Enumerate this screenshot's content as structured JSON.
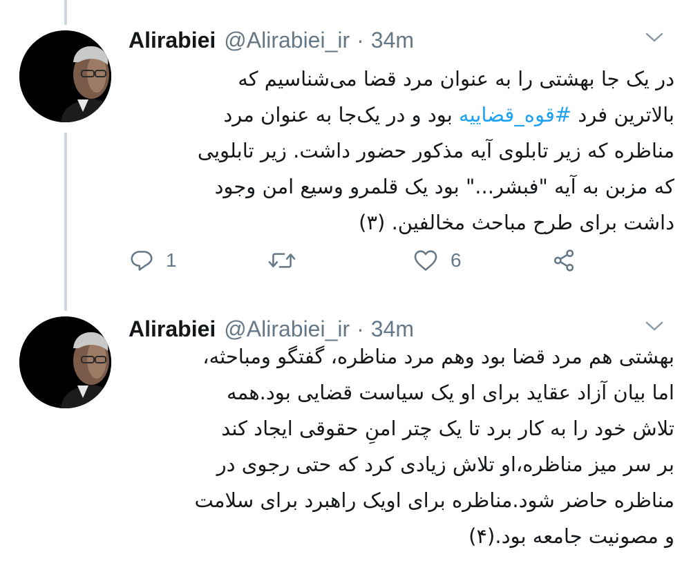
{
  "tweets": [
    {
      "author": {
        "name": "Alirabiei",
        "handle": "@Alirabiei_ir",
        "avatar": "person-portrait"
      },
      "separator": "·",
      "time": "34m",
      "lines": [
        [
          {
            "text": "در یک جا بهشتی را به عنوان مرد قضا می‌شناسیم که"
          }
        ],
        [
          {
            "text": "بالاترین فرد "
          },
          {
            "text": "#قوه_قضاییه",
            "hashtag": true
          },
          {
            "text": " بود و در یک‌جا به عنوان مرد"
          }
        ],
        [
          {
            "text": "مناظره که زیر تابلوی آیه مذکور حضور داشت. زیر تابلویی"
          }
        ],
        [
          {
            "text": "که مزبن به آیه \"فبشر...\" بود یک قلمرو وسیع امن وجود"
          }
        ],
        [
          {
            "text": "داشت برای طرح مباحث مخالفین. (۳)"
          }
        ]
      ],
      "actions": {
        "reply": {
          "icon": "reply-icon",
          "count": "1"
        },
        "retweet": {
          "icon": "retweet-icon",
          "count": ""
        },
        "like": {
          "icon": "heart-icon",
          "count": "6"
        },
        "share": {
          "icon": "share-icon",
          "count": ""
        }
      }
    },
    {
      "author": {
        "name": "Alirabiei",
        "handle": "@Alirabiei_ir",
        "avatar": "person-portrait"
      },
      "separator": "·",
      "time": "34m",
      "lines": [
        [
          {
            "text": "بهشتی هم مرد قضا بود وهم مرد مناظره، گفتگو ومباحثه،"
          }
        ],
        [
          {
            "text": "اما بیان آزاد عقاید برای او یک سیاست قضایی بود.همه"
          }
        ],
        [
          {
            "text": "تلاش خود را به کار برد تا یک چتر امنِ حقوقی ایجاد کند"
          }
        ],
        [
          {
            "text": "بر سر میز مناظره،او تلاش زیادی کرد که حتی رجوی در"
          }
        ],
        [
          {
            "text": "مناظره حاضر شود.مناظره برای اویک راهبرد برای سلامت"
          }
        ],
        [
          {
            "text": "و مصونیت جامعه بود.(۴)"
          }
        ]
      ]
    }
  ],
  "colors": {
    "text": "#14171a",
    "muted": "#657786",
    "hashtag": "#1da1f2",
    "thread_line": "#ccd6dd"
  }
}
